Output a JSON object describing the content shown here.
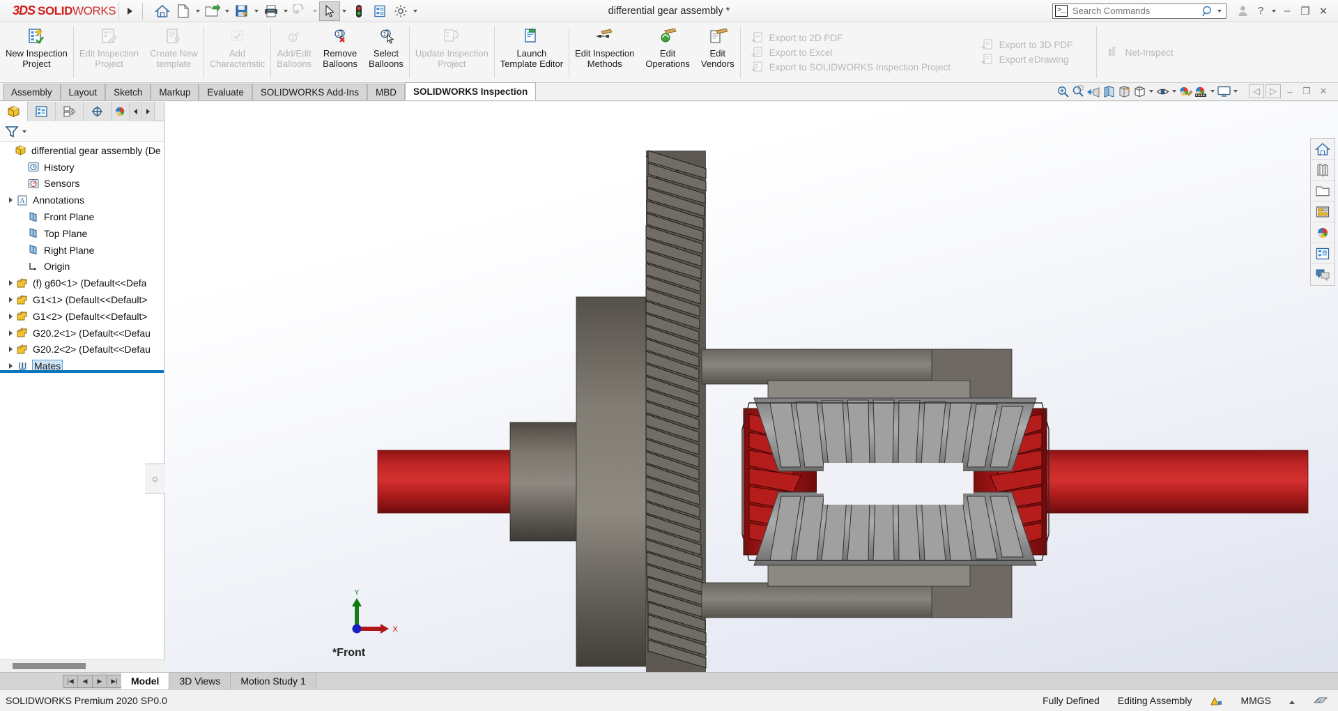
{
  "app": {
    "brand_ds": "3DS",
    "brand_solid": "SOLID",
    "brand_works": "WORKS",
    "document_title": "differential gear assembly *",
    "accent_red": "#d21a1a",
    "accent_blue": "#0f76bc"
  },
  "titlebar": {
    "icons": [
      {
        "name": "home-icon",
        "label": "Home"
      },
      {
        "name": "new-document-icon",
        "label": "New"
      },
      {
        "name": "open-folder-icon",
        "label": "Open"
      },
      {
        "name": "save-icon",
        "label": "Save"
      },
      {
        "name": "print-icon",
        "label": "Print"
      },
      {
        "name": "undo-icon",
        "label": "Undo"
      },
      {
        "name": "select-arrow-icon",
        "label": "Select"
      },
      {
        "name": "rebuild-icon",
        "label": "Rebuild"
      },
      {
        "name": "file-properties-icon",
        "label": "File Properties"
      },
      {
        "name": "options-gear-icon",
        "label": "Options"
      }
    ],
    "search": {
      "placeholder": "Search Commands",
      "value": "",
      "icon": "command-prompt-icon",
      "dropdown": "chevron-down-icon"
    },
    "window_buttons": {
      "account": "user-account-icon",
      "help": "?",
      "help_caret": "chevron-down-icon",
      "minimize": "–",
      "restore": "❐",
      "close": "✕"
    }
  },
  "ribbon": {
    "groups": [
      {
        "buttons": [
          {
            "label_line1": "New Inspection",
            "label_line2": "Project",
            "enabled": true,
            "icon": "new-inspection-project-icon"
          }
        ]
      },
      {
        "buttons": [
          {
            "label_line1": "Edit Inspection",
            "label_line2": "Project",
            "enabled": false,
            "icon": "edit-inspection-project-icon"
          },
          {
            "label_line1": "Create New",
            "label_line2": "template",
            "enabled": false,
            "icon": "create-new-template-icon"
          }
        ]
      },
      {
        "buttons": [
          {
            "label_line1": "Add",
            "label_line2": "Characteristic",
            "enabled": false,
            "icon": "add-characteristic-icon"
          }
        ]
      },
      {
        "buttons": [
          {
            "label_line1": "Add/Edit",
            "label_line2": "Balloons",
            "enabled": false,
            "icon": "add-edit-balloons-icon"
          },
          {
            "label_line1": "Remove",
            "label_line2": "Balloons",
            "enabled": true,
            "icon": "remove-balloons-icon"
          },
          {
            "label_line1": "Select",
            "label_line2": "Balloons",
            "enabled": true,
            "icon": "select-balloons-icon"
          }
        ]
      },
      {
        "buttons": [
          {
            "label_line1": "Update Inspection",
            "label_line2": "Project",
            "enabled": false,
            "icon": "update-inspection-project-icon"
          }
        ]
      },
      {
        "buttons": [
          {
            "label_line1": "Launch",
            "label_line2": "Template Editor",
            "enabled": true,
            "icon": "launch-template-editor-icon"
          }
        ]
      },
      {
        "buttons": [
          {
            "label_line1": "Edit Inspection",
            "label_line2": "Methods",
            "enabled": true,
            "icon": "edit-inspection-methods-icon"
          },
          {
            "label_line1": "Edit",
            "label_line2": "Operations",
            "enabled": true,
            "icon": "edit-operations-icon"
          },
          {
            "label_line1": "Edit",
            "label_line2": "Vendors",
            "enabled": true,
            "icon": "edit-vendors-icon"
          }
        ]
      }
    ],
    "export_column_1": [
      {
        "label": "Export to 2D PDF",
        "enabled": false,
        "icon": "export-2d-pdf-icon"
      },
      {
        "label": "Export to Excel",
        "enabled": false,
        "icon": "export-excel-icon"
      },
      {
        "label": "Export to SOLIDWORKS Inspection Project",
        "enabled": false,
        "icon": "export-sw-inspection-icon"
      }
    ],
    "export_column_2": [
      {
        "label": "Export to 3D PDF",
        "enabled": false,
        "icon": "export-3d-pdf-icon"
      },
      {
        "label": "Export eDrawing",
        "enabled": false,
        "icon": "export-edrawing-icon"
      }
    ],
    "net_inspect": [
      {
        "label": "Net-Inspect",
        "enabled": false,
        "icon": "net-inspect-icon"
      }
    ]
  },
  "command_tabs": {
    "items": [
      {
        "label": "Assembly",
        "active": false
      },
      {
        "label": "Layout",
        "active": false
      },
      {
        "label": "Sketch",
        "active": false
      },
      {
        "label": "Markup",
        "active": false
      },
      {
        "label": "Evaluate",
        "active": false
      },
      {
        "label": "SOLIDWORKS Add-Ins",
        "active": false
      },
      {
        "label": "MBD",
        "active": false
      },
      {
        "label": "SOLIDWORKS Inspection",
        "active": true
      }
    ],
    "view_tools": [
      {
        "name": "zoom-to-fit-icon",
        "caret": false
      },
      {
        "name": "zoom-to-area-icon",
        "caret": false
      },
      {
        "name": "previous-view-icon",
        "caret": false
      },
      {
        "name": "section-view-icon",
        "caret": false
      },
      {
        "name": "view-orientation-icon",
        "caret": false
      },
      {
        "name": "display-style-icon",
        "caret": true
      },
      {
        "name": "hide-show-items-icon",
        "caret": true
      },
      {
        "name": "edit-appearance-icon",
        "caret": false
      },
      {
        "name": "apply-scene-icon",
        "caret": true
      },
      {
        "name": "view-settings-icon",
        "caret": true
      }
    ],
    "doc_controls": [
      "◁",
      "▷",
      "–",
      "❐",
      "✕"
    ]
  },
  "feature_manager": {
    "tabs": [
      {
        "name": "feature-manager-tab",
        "active": true
      },
      {
        "name": "property-manager-tab",
        "active": false
      },
      {
        "name": "configuration-manager-tab",
        "active": false
      },
      {
        "name": "dimxpert-manager-tab",
        "active": false
      },
      {
        "name": "display-manager-tab",
        "active": false
      }
    ],
    "filter_icon": "filter-icon",
    "tree": [
      {
        "label": "differential gear assembly  (De",
        "icon": "assembly-icon",
        "indent": 0,
        "expandable": false,
        "selected": false
      },
      {
        "label": "History",
        "icon": "history-icon",
        "indent": 1,
        "expandable": false,
        "selected": false
      },
      {
        "label": "Sensors",
        "icon": "sensors-icon",
        "indent": 1,
        "expandable": false,
        "selected": false
      },
      {
        "label": "Annotations",
        "icon": "annotations-icon",
        "indent": 1,
        "expandable": true,
        "selected": false
      },
      {
        "label": "Front Plane",
        "icon": "plane-icon",
        "indent": 1,
        "expandable": false,
        "selected": false
      },
      {
        "label": "Top Plane",
        "icon": "plane-icon",
        "indent": 1,
        "expandable": false,
        "selected": false
      },
      {
        "label": "Right Plane",
        "icon": "plane-icon",
        "indent": 1,
        "expandable": false,
        "selected": false
      },
      {
        "label": "Origin",
        "icon": "origin-icon",
        "indent": 1,
        "expandable": false,
        "selected": false
      },
      {
        "label": "(f) g60<1>  (Default<<Defa",
        "icon": "part-icon",
        "indent": 1,
        "expandable": true,
        "selected": false
      },
      {
        "label": "G1<1>  (Default<<Default>",
        "icon": "part-icon",
        "indent": 1,
        "expandable": true,
        "selected": false
      },
      {
        "label": "G1<2>  (Default<<Default>",
        "icon": "part-icon",
        "indent": 1,
        "expandable": true,
        "selected": false
      },
      {
        "label": "G20.2<1>  (Default<<Defau",
        "icon": "part-icon",
        "indent": 1,
        "expandable": true,
        "selected": false
      },
      {
        "label": "G20.2<2>  (Default<<Defau",
        "icon": "part-icon",
        "indent": 1,
        "expandable": true,
        "selected": false
      },
      {
        "label": "Mates",
        "icon": "mates-icon",
        "indent": 1,
        "expandable": true,
        "selected": true
      }
    ]
  },
  "graphics": {
    "view_label": "*Front",
    "triad": {
      "x_axis": "X",
      "y_axis": "Y",
      "x_color": "#cc0000",
      "y_color": "#009000",
      "z_color": "#0000cc"
    },
    "model_colors": {
      "shaft_red": "#a81c1c",
      "shaft_red_light": "#c52a2a",
      "housing_gray": "#6b665e",
      "gear_gray": "#8c8c8c",
      "bevel_red": "#a01414",
      "background_top": "#ffffff",
      "background_bottom": "#dfe3ee"
    }
  },
  "right_toolbar": [
    {
      "name": "view-home-icon"
    },
    {
      "name": "appearances-library-icon"
    },
    {
      "name": "design-library-folder-icon"
    },
    {
      "name": "file-explorer-icon"
    },
    {
      "name": "search-web-icon"
    },
    {
      "name": "view-palette-icon"
    },
    {
      "name": "custom-properties-icon"
    }
  ],
  "bottom": {
    "nav_buttons": [
      "|◀",
      "◀",
      "▶",
      "▶|"
    ],
    "tabs": [
      {
        "label": "Model",
        "active": true
      },
      {
        "label": "3D Views",
        "active": false
      },
      {
        "label": "Motion Study 1",
        "active": false
      }
    ]
  },
  "statusbar": {
    "left": "SOLIDWORKS Premium 2020 SP0.0",
    "fully_defined": "Fully Defined",
    "editing": "Editing Assembly",
    "edit_icon": "editing-assembly-icon",
    "units": "MMGS",
    "units_caret": "chevron-up-icon",
    "overlay_icon": "overlay-icon"
  }
}
